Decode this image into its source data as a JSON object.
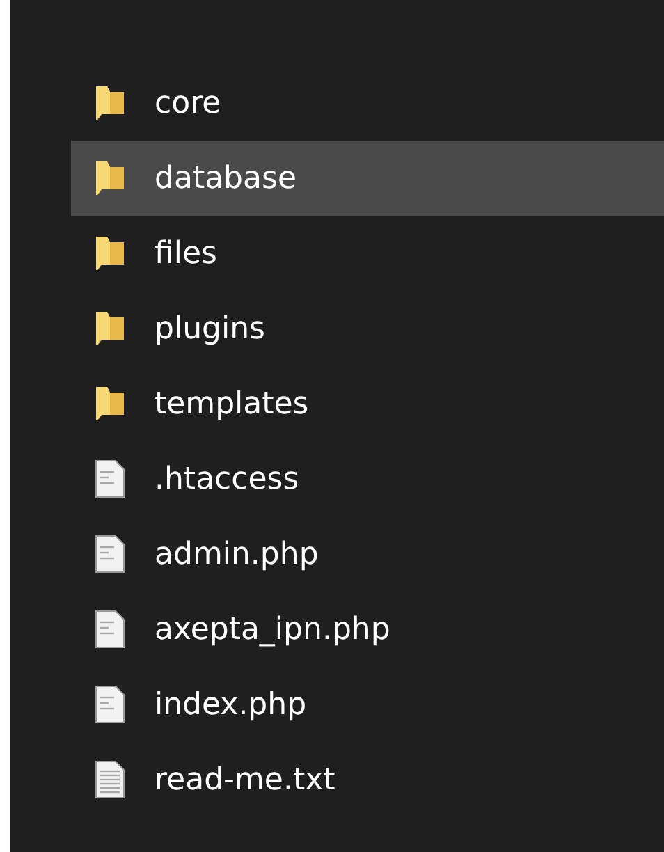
{
  "items": [
    {
      "name": "core",
      "kind": "folder",
      "selected": false
    },
    {
      "name": "database",
      "kind": "folder",
      "selected": true
    },
    {
      "name": "files",
      "kind": "folder",
      "selected": false
    },
    {
      "name": "plugins",
      "kind": "folder",
      "selected": false
    },
    {
      "name": "templates",
      "kind": "folder",
      "selected": false
    },
    {
      "name": ".htaccess",
      "kind": "file",
      "selected": false
    },
    {
      "name": "admin.php",
      "kind": "file",
      "selected": false
    },
    {
      "name": "axepta_ipn.php",
      "kind": "file",
      "selected": false
    },
    {
      "name": "index.php",
      "kind": "file",
      "selected": false
    },
    {
      "name": "read-me.txt",
      "kind": "text",
      "selected": false
    }
  ]
}
